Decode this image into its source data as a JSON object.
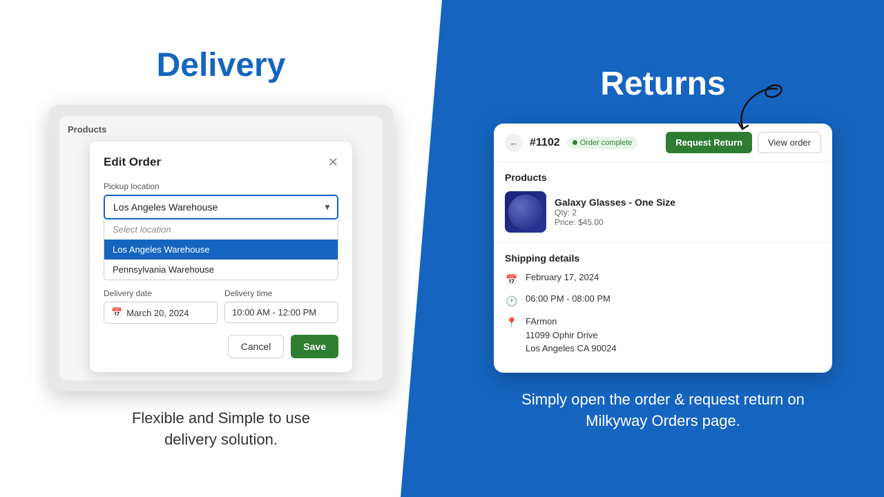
{
  "left": {
    "title": "Delivery",
    "description": "Flexible and Simple to use\ndelivery solution.",
    "tablet": {
      "topbar_label": "Products",
      "modal": {
        "title": "Edit Order",
        "pickup_label": "Pickup location",
        "pickup_selected": "Los Angeles Warehouse",
        "dropdown_items": [
          {
            "label": "Select location",
            "type": "header"
          },
          {
            "label": "Los Angeles Warehouse",
            "type": "selected"
          },
          {
            "label": "Pennsylvania Warehouse",
            "type": "normal"
          }
        ],
        "delivery_date_label": "Delivery date",
        "delivery_date_value": "March 20, 2024",
        "delivery_time_label": "Delivery time",
        "delivery_time_value": "10:00 AM - 12:00 PM",
        "cancel_label": "Cancel",
        "save_label": "Save"
      }
    }
  },
  "right": {
    "title": "Returns",
    "description": "Simply open the order & request return\non Milkyway Orders page.",
    "card": {
      "order_number": "#1102",
      "status": "Order complete",
      "btn_request_return": "Request Return",
      "btn_view_order": "View order",
      "products_section": "Products",
      "product_name": "Galaxy Glasses - One Size",
      "product_qty": "Qty: 2",
      "product_price": "Price: $45.00",
      "shipping_section": "Shipping details",
      "shipping_date": "February 17, 2024",
      "shipping_time": "06:00 PM - 08:00 PM",
      "shipping_name": "FArmon",
      "shipping_address_line1": "11099 Ophir Drive",
      "shipping_address_line2": "Los Angeles CA 90024"
    }
  }
}
